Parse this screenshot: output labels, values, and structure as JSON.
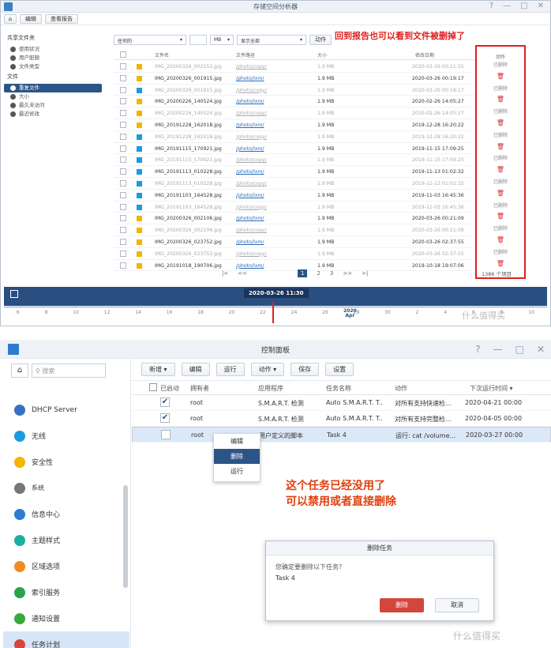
{
  "p1": {
    "title": "存储空间分析器",
    "toolbar": {
      "edit": "编辑",
      "view_report": "查看报告"
    },
    "sidebar": {
      "group1": "共享文件夹",
      "g1_items": [
        "使用状况",
        "用户配额",
        "文件类型"
      ],
      "group2": "文件",
      "g2_items": [
        "重复文件",
        "大小",
        "最久未访问",
        "最近修改"
      ]
    },
    "filters": {
      "any": "任何的",
      "unit": "MB",
      "show_all": "显示全部",
      "action": "动作"
    },
    "columns": {
      "name": "文件名",
      "path": "文件路径",
      "size": "大小",
      "modified": "修改日期",
      "action": "动作"
    },
    "rows": [
      {
        "name": "IMG_20200326_002153.jpg",
        "path": "/photo/copy/",
        "size": "1.9 MB",
        "date": "2020-03-26 00:21:55",
        "color": "#f4b400",
        "deleted": true
      },
      {
        "name": "IMG_20200326_001915.jpg",
        "path": "/photo/lxm/",
        "size": "1.9 MB",
        "date": "2020-03-26 00:19:17",
        "color": "#f4b400",
        "deleted": false
      },
      {
        "name": "IMG_20200326_001915.jpg",
        "path": "/photo/copy/",
        "size": "1.9 MB",
        "date": "2020-03-26 00:19:17",
        "color": "#1a9be0",
        "deleted": true
      },
      {
        "name": "IMG_20200226_140524.jpg",
        "path": "/photo/lxm/",
        "size": "1.9 MB",
        "date": "2020-02-26 14:05:27",
        "color": "#f4b400",
        "deleted": false
      },
      {
        "name": "IMG_20200226_140524.jpg",
        "path": "/photo/copy/",
        "size": "1.9 MB",
        "date": "2020-02-26 14:05:27",
        "color": "#f4b400",
        "deleted": true
      },
      {
        "name": "IMG_20191228_162018.jpg",
        "path": "/photo/lxm/",
        "size": "1.9 MB",
        "date": "2019-12-28 16:20:22",
        "color": "#f4b400",
        "deleted": false
      },
      {
        "name": "IMG_20191228_162018.jpg",
        "path": "/photo/copy/",
        "size": "1.9 MB",
        "date": "2019-12-28 16:20:22",
        "color": "#1a9be0",
        "deleted": true
      },
      {
        "name": "IMG_20191115_170921.jpg",
        "path": "/photo/lxm/",
        "size": "1.9 MB",
        "date": "2019-11-15 17:09:25",
        "color": "#1a9be0",
        "deleted": false
      },
      {
        "name": "IMG_20191115_170921.jpg",
        "path": "/photo/copy/",
        "size": "1.9 MB",
        "date": "2019-11-15 17:09:25",
        "color": "#1a9be0",
        "deleted": true
      },
      {
        "name": "IMG_20191113_010228.jpg",
        "path": "/photo/lxm/",
        "size": "1.9 MB",
        "date": "2019-11-13 01:02:32",
        "color": "#1a9be0",
        "deleted": false
      },
      {
        "name": "IMG_20191113_010228.jpg",
        "path": "/photo/copy/",
        "size": "1.9 MB",
        "date": "2019-11-13 01:02:32",
        "color": "#1a9be0",
        "deleted": true
      },
      {
        "name": "IMG_20191103_164528.jpg",
        "path": "/photo/lxm/",
        "size": "1.9 MB",
        "date": "2019-11-03 16:45:36",
        "color": "#1a9be0",
        "deleted": false
      },
      {
        "name": "IMG_20191103_164528.jpg",
        "path": "/photo/copy/",
        "size": "1.9 MB",
        "date": "2019-11-03 16:45:36",
        "color": "#1a9be0",
        "deleted": true
      },
      {
        "name": "IMG_20200326_002106.jpg",
        "path": "/photo/lxm/",
        "size": "1.9 MB",
        "date": "2020-03-26 00:21:09",
        "color": "#f4b400",
        "deleted": false
      },
      {
        "name": "IMG_20200326_002106.jpg",
        "path": "/photo/copy/",
        "size": "1.9 MB",
        "date": "2020-03-26 00:21:09",
        "color": "#f4b400",
        "deleted": true
      },
      {
        "name": "IMG_20200326_023752.jpg",
        "path": "/photo/lxm/",
        "size": "1.9 MB",
        "date": "2020-03-26 02:37:55",
        "color": "#f4b400",
        "deleted": false
      },
      {
        "name": "IMG_20200326_023752.jpg",
        "path": "/photo/copy/",
        "size": "1.9 MB",
        "date": "2020-03-26 02:37:55",
        "color": "#f4b400",
        "deleted": true
      },
      {
        "name": "IMG_20191018_190706.jpg",
        "path": "/photo/lxm/",
        "size": "1.9 MB",
        "date": "2019-10-18 19:07:06",
        "color": "#f4b400",
        "deleted": false
      }
    ],
    "deleted_label": "已删除",
    "trash_glyph": "🗑",
    "pager": {
      "first": "|<",
      "prev": "<<",
      "current": "1",
      "p2": "2",
      "p3": "3",
      "next": ">>",
      "last": ">|"
    },
    "total": "1386 个项目",
    "annotation": "回到报告也可以看到文件被删掉了",
    "timeline": {
      "badge": "2020-03-26 11:30",
      "ticks": [
        "6",
        "8",
        "10",
        "12",
        "14",
        "16",
        "18",
        "20",
        "22",
        "24",
        "26",
        "28",
        "30",
        "2",
        "4",
        "6",
        "8",
        "10"
      ],
      "year": "2020",
      "month": "Apr"
    },
    "watermark": "什么值得买"
  },
  "p2": {
    "title": "控制面板",
    "search_placeholder": "搜索",
    "nav": [
      {
        "label": "DHCP Server",
        "color": "#3b6fc4"
      },
      {
        "label": "无线",
        "color": "#1a9be0"
      },
      {
        "label": "安全性",
        "color": "#f4b400"
      },
      {
        "label": "系统",
        "color": "#777"
      },
      {
        "label": "信息中心",
        "color": "#2d7bd1"
      },
      {
        "label": "主题样式",
        "color": "#1ab0a0"
      },
      {
        "label": "区域选项",
        "color": "#f08a24"
      },
      {
        "label": "索引服务",
        "color": "#2aa24a"
      },
      {
        "label": "通知设置",
        "color": "#3aa83a"
      },
      {
        "label": "任务计划",
        "color": "#d3463c"
      }
    ],
    "toolbar": {
      "create": "新增 ▾",
      "edit": "编辑",
      "run": "运行",
      "action": "动作 ▾",
      "save": "保存",
      "settings": "设置"
    },
    "columns": {
      "enabled": "已启动",
      "owner": "拥有者",
      "app": "应用程序",
      "task": "任务名称",
      "action": "动作",
      "next": "下次运行时间 ▾"
    },
    "rows": [
      {
        "checked": "✔",
        "owner": "root",
        "app": "S.M.A.R.T. 检测",
        "task": "Auto S.M.A.R.T. T..",
        "action": "对所有支持快速检...",
        "next": "2020-04-21 00:00"
      },
      {
        "checked": "✔",
        "owner": "root",
        "app": "S.M.A.R.T. 检测",
        "task": "Auto S.M.A.R.T. T..",
        "action": "对所有支持完整检...",
        "next": "2020-04-05 00:00"
      },
      {
        "checked": "",
        "owner": "root",
        "app": "用户定义的脚本",
        "task": "Task 4",
        "action": "运行: cat /volume...",
        "next": "2020-03-27 00:00"
      }
    ],
    "context_menu": [
      "编辑",
      "删除",
      "运行"
    ],
    "annotation_line1": "这个任务已经没用了",
    "annotation_line2": "可以禁用或者直接删除",
    "dialog": {
      "title": "删除任务",
      "question": "您确定要删除以下任务?",
      "task": "Task 4",
      "delete": "删除",
      "cancel": "取消"
    },
    "watermark": "什么值得买"
  }
}
